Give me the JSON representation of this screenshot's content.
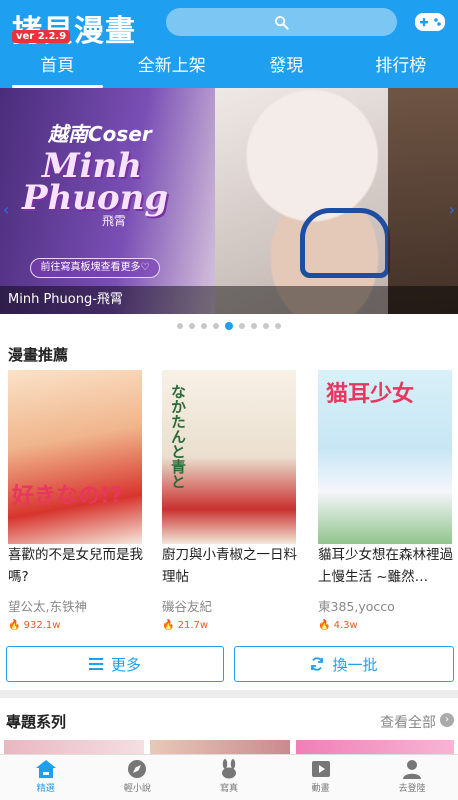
{
  "header": {
    "logo": "拷貝漫畫",
    "version": "ver 2.2.9",
    "tabs": [
      {
        "label": "首頁",
        "active": true
      },
      {
        "label": "全新上架",
        "active": false
      },
      {
        "label": "發現",
        "active": false
      },
      {
        "label": "排行榜",
        "active": false
      }
    ],
    "search_icon": "search-icon",
    "game_icon": "gamepad-icon"
  },
  "banner": {
    "coser_label": "越南Coser",
    "name_line1": "Minh",
    "name_line2": "Phuong",
    "subtitle": "飛霄",
    "cta": "前往寫真板塊查看更多♡",
    "caption": "Minh Phuong-飛霄",
    "page_count": 9,
    "active_index": 4
  },
  "recommend": {
    "title": "漫畫推薦",
    "items": [
      {
        "cover_text": "好きなの!?",
        "name": "喜歡的不是女兒而是我嗎?",
        "author": "望公太,东铁神",
        "views": "932.1w"
      },
      {
        "cover_text": "なかたんと青と",
        "name": "廚刀與小青椒之一日料理帖",
        "author": "磯谷友紀",
        "views": "21.7w"
      },
      {
        "cover_text": "猫耳少女",
        "name": "貓耳少女想在森林裡過上慢生活 ~雖然…",
        "author": "東385,yocco",
        "views": "4.3w"
      }
    ],
    "more_label": "更多",
    "refresh_label": "換一批"
  },
  "topic": {
    "title": "專題系列",
    "view_all": "查看全部"
  },
  "nav": {
    "items": [
      {
        "label": "精選",
        "icon": "home-icon",
        "active": true
      },
      {
        "label": "輕小說",
        "icon": "compass-icon",
        "active": false
      },
      {
        "label": "寫真",
        "icon": "bunny-icon",
        "active": false
      },
      {
        "label": "動畫",
        "icon": "play-icon",
        "active": false
      },
      {
        "label": "去登陸",
        "icon": "user-icon",
        "active": false
      }
    ]
  },
  "colors": {
    "primary": "#1e9ff0",
    "version_badge": "#e8323e",
    "views": "#e35a26"
  }
}
